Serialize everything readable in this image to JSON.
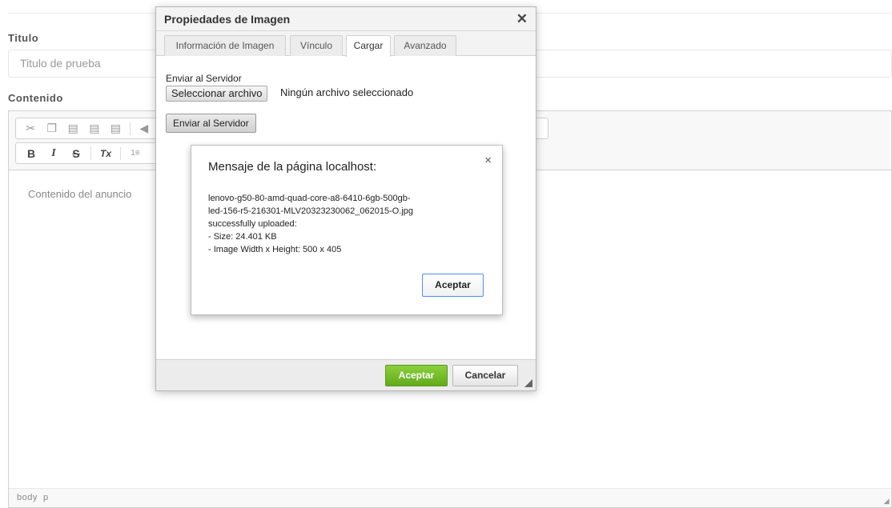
{
  "form": {
    "title_label": "Titulo",
    "title_value": "Titulo de prueba",
    "content_label": "Contenido"
  },
  "editor": {
    "content_text": "Contenido del anuncio",
    "footer_path": "body  p",
    "toolbar_row1": [
      "cut-icon",
      "copy-icon",
      "paste-icon",
      "paste-text-icon",
      "paste-word-icon",
      "undo-icon"
    ],
    "toolbar_row2": {
      "bold": "B",
      "italic": "I",
      "strike": "S",
      "clear_format": "Tx",
      "numbered_list": "1≡"
    }
  },
  "dialog": {
    "title": "Propiedades de Imagen",
    "tabs": [
      {
        "label": "Información de Imagen",
        "active": false
      },
      {
        "label": "Vínculo",
        "active": false
      },
      {
        "label": "Cargar",
        "active": true
      },
      {
        "label": "Avanzado",
        "active": false
      }
    ],
    "upload_label": "Enviar al Servidor",
    "file_button": "Seleccionar archivo",
    "file_status": "Ningún archivo seleccionado",
    "send_button": "Enviar al Servidor",
    "ok_button": "Aceptar",
    "cancel_button": "Cancelar"
  },
  "alert": {
    "title": "Mensaje de la página localhost:",
    "message_lines": [
      "lenovo-g50-80-amd-quad-core-a8-6410-6gb-500gb-",
      "led-156-r5-216301-MLV20323230062_062015-O.jpg",
      "successfully uploaded:",
      "- Size: 24.401 KB",
      "- Image Width x Height: 500 x 405"
    ],
    "ok_button": "Aceptar"
  },
  "colors": {
    "ok_green": "#6bb325",
    "alert_focus_blue": "#4d90fe"
  }
}
